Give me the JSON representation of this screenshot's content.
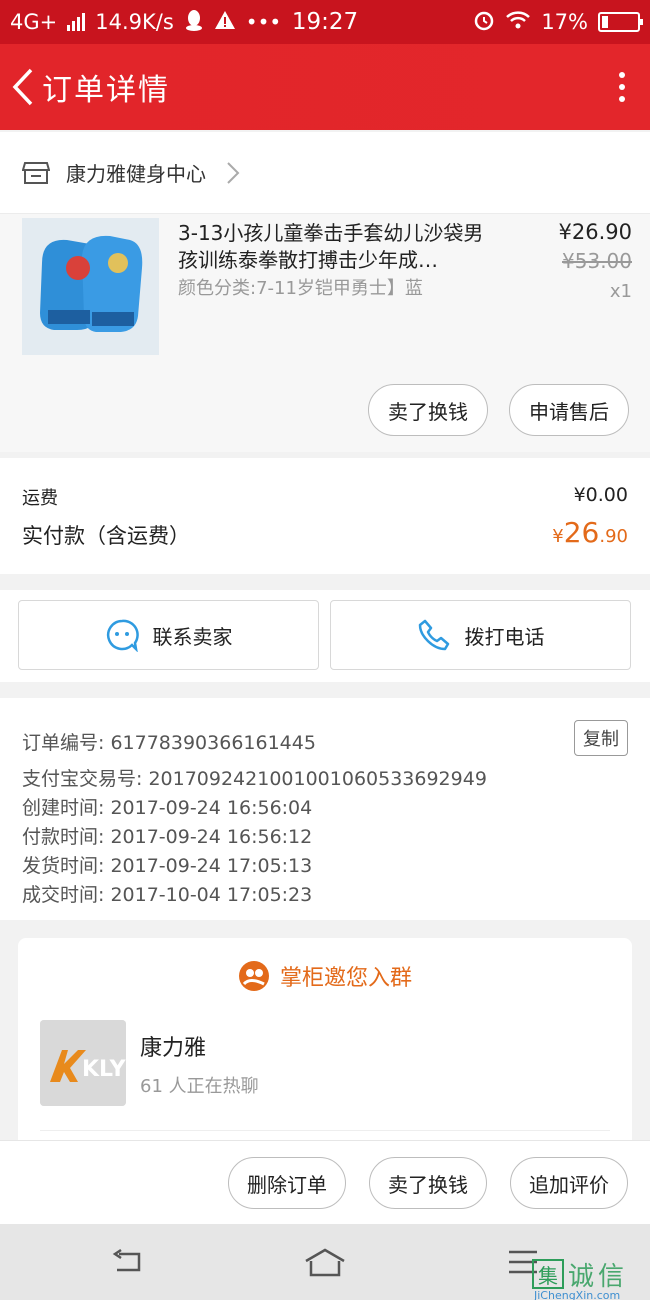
{
  "status_bar": {
    "network": "4G+",
    "speed": "14.9K/s",
    "time": "19:27",
    "battery": "17%",
    "icons": [
      "signal-icon",
      "qq-icon",
      "warning-icon",
      "more-dots-icon",
      "alarm-icon",
      "wifi-icon",
      "battery-icon"
    ]
  },
  "header": {
    "title": "订单详情",
    "color": "#e2252a"
  },
  "shop": {
    "name": "康力雅健身中心"
  },
  "product": {
    "name": "3-13小孩儿童拳击手套幼儿沙袋男孩训练泰拳散打搏击少年成…",
    "sku": "颜色分类:7-11岁铠甲勇士】蓝",
    "price": "¥26.90",
    "original_price": "¥53.00",
    "quantity": "x1",
    "sell_button": "卖了换钱",
    "after_sale_button": "申请售后"
  },
  "fees": {
    "shipping_label": "运费",
    "shipping_value": "¥0.00",
    "total_label": "实付款（含运费）",
    "total_currency": "¥",
    "total_integer": "26",
    "total_decimal": ".90",
    "accent_color": "#e36a1a"
  },
  "contact": {
    "seller_label": "联系卖家",
    "call_label": "拨打电话"
  },
  "order_info": {
    "copy_label": "复制",
    "rows": [
      "订单编号: 61778390366161445",
      "支付宝交易号: 2017092421001001060533692949",
      "创建时间: 2017-09-24 16:56:04",
      "付款时间: 2017-09-24 16:56:12",
      "发货时间: 2017-09-24 17:05:13",
      "成交时间: 2017-10-04 17:05:23"
    ]
  },
  "group": {
    "title": "掌柜邀您入群",
    "name": "康力雅",
    "count": "61 人正在热聊",
    "logo_text": "KLY"
  },
  "bottom_actions": {
    "delete": "删除订单",
    "sell": "卖了换钱",
    "review": "追加评价"
  },
  "watermark": {
    "text": "诚信",
    "box_char": "集",
    "sub": "JiChengXin.com"
  }
}
